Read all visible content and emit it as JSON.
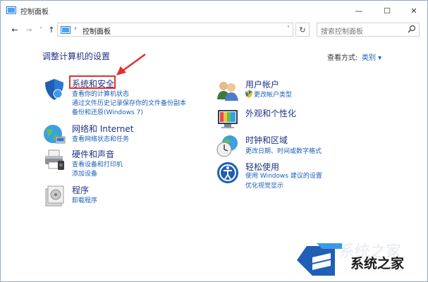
{
  "window": {
    "title": "控制面板",
    "minimize": "—",
    "maximize": "☐",
    "close": "✕"
  },
  "nav": {
    "back": "←",
    "forward": "→",
    "recent": "˅",
    "up": "↑",
    "breadcrumb_sep": "›",
    "address": "控制面板",
    "address_drop": "˅",
    "refresh": "↻",
    "search_placeholder": "搜索控制面板"
  },
  "content": {
    "heading": "调整计算机的设置",
    "view_by_label": "查看方式:",
    "view_by_value": "类别 ▾"
  },
  "left_categories": [
    {
      "icon": "shield-icon",
      "title": "系统和安全",
      "links": [
        "查看你的计算机状态",
        "通过文件历史记录保存你的文件备份副本",
        "备份和还原(Windows 7)"
      ]
    },
    {
      "icon": "network-globe-icon",
      "title": "网络和 Internet",
      "links": [
        "查看网络状态和任务"
      ]
    },
    {
      "icon": "printer-icon",
      "title": "硬件和声音",
      "links": [
        "查看设备和打印机",
        "添加设备"
      ]
    },
    {
      "icon": "programs-icon",
      "title": "程序",
      "links": [
        "卸载程序"
      ]
    }
  ],
  "right_categories": [
    {
      "icon": "users-icon",
      "title": "用户帐户",
      "links": [
        "更改帐户类型"
      ]
    },
    {
      "icon": "appearance-icon",
      "title": "外观和个性化",
      "links": []
    },
    {
      "icon": "clock-globe-icon",
      "title": "时钟和区域",
      "links": [
        "更改日期、时间或数字格式"
      ]
    },
    {
      "icon": "ease-of-access-icon",
      "title": "轻松使用",
      "links": [
        "使用 Windows 建议的设置",
        "优化视觉显示"
      ]
    }
  ],
  "watermark": {
    "text": "系统之家",
    "bg_text": "系统之家"
  },
  "colors": {
    "heading": "#1e3287",
    "link": "#1c5fb8",
    "highlight": "#e03030"
  }
}
